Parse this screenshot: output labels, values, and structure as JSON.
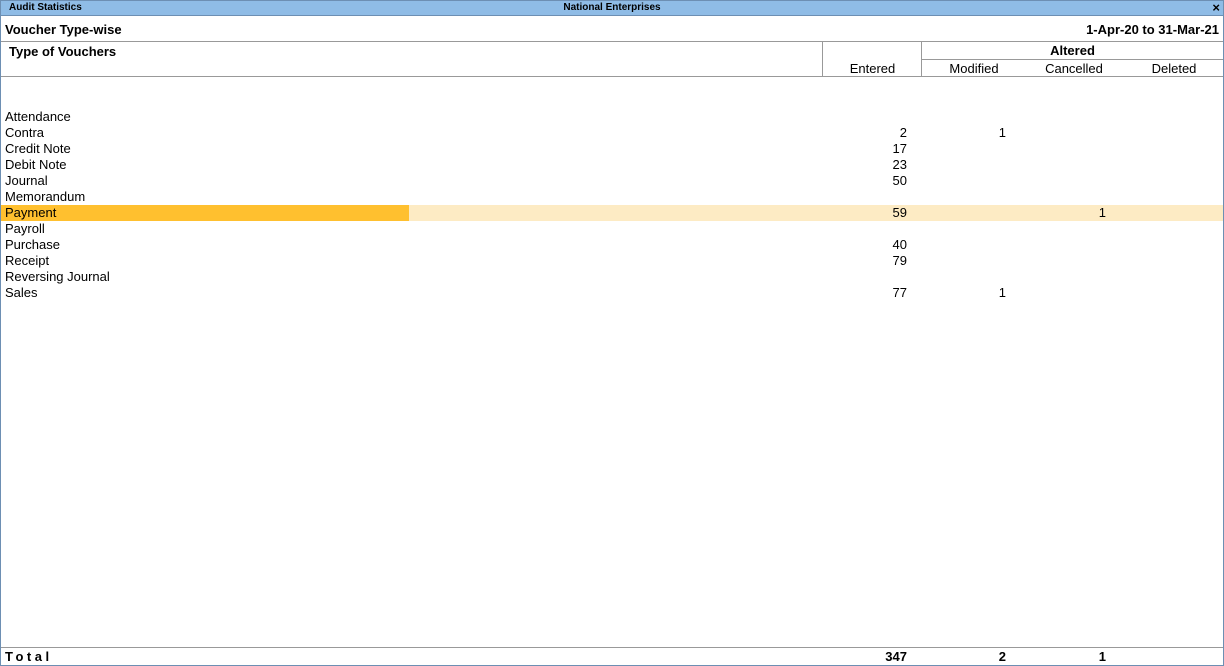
{
  "titlebar": {
    "left": "Audit Statistics",
    "center": "National Enterprises",
    "close_glyph": "×",
    "close_icon": "close-icon"
  },
  "header": {
    "report_title": "Voucher Type-wise",
    "period": "1-Apr-20 to 31-Mar-21"
  },
  "columns": {
    "type": "Type of Vouchers",
    "entered": "Entered",
    "altered": "Altered",
    "modified": "Modified",
    "cancelled": "Cancelled",
    "deleted": "Deleted"
  },
  "rows": [
    {
      "name": "Attendance",
      "entered": "",
      "modified": "",
      "cancelled": "",
      "deleted": ""
    },
    {
      "name": "Contra",
      "entered": "2",
      "modified": "1",
      "cancelled": "",
      "deleted": ""
    },
    {
      "name": "Credit Note",
      "entered": "17",
      "modified": "",
      "cancelled": "",
      "deleted": ""
    },
    {
      "name": "Debit Note",
      "entered": "23",
      "modified": "",
      "cancelled": "",
      "deleted": ""
    },
    {
      "name": "Journal",
      "entered": "50",
      "modified": "",
      "cancelled": "",
      "deleted": ""
    },
    {
      "name": "Memorandum",
      "entered": "",
      "modified": "",
      "cancelled": "",
      "deleted": ""
    },
    {
      "name": "Payment",
      "entered": "59",
      "modified": "",
      "cancelled": "1",
      "deleted": "",
      "selected": true
    },
    {
      "name": "Payroll",
      "entered": "",
      "modified": "",
      "cancelled": "",
      "deleted": ""
    },
    {
      "name": "Purchase",
      "entered": "40",
      "modified": "",
      "cancelled": "",
      "deleted": ""
    },
    {
      "name": "Receipt",
      "entered": "79",
      "modified": "",
      "cancelled": "",
      "deleted": ""
    },
    {
      "name": "Reversing Journal",
      "entered": "",
      "modified": "",
      "cancelled": "",
      "deleted": ""
    },
    {
      "name": "Sales",
      "entered": "77",
      "modified": "1",
      "cancelled": "",
      "deleted": ""
    }
  ],
  "total": {
    "label": "Total",
    "entered": "347",
    "modified": "2",
    "cancelled": "1",
    "deleted": ""
  },
  "colors": {
    "titlebar": "#8fbce6",
    "selected_name": "#ffc02f",
    "selected_row": "#fdebc4"
  }
}
